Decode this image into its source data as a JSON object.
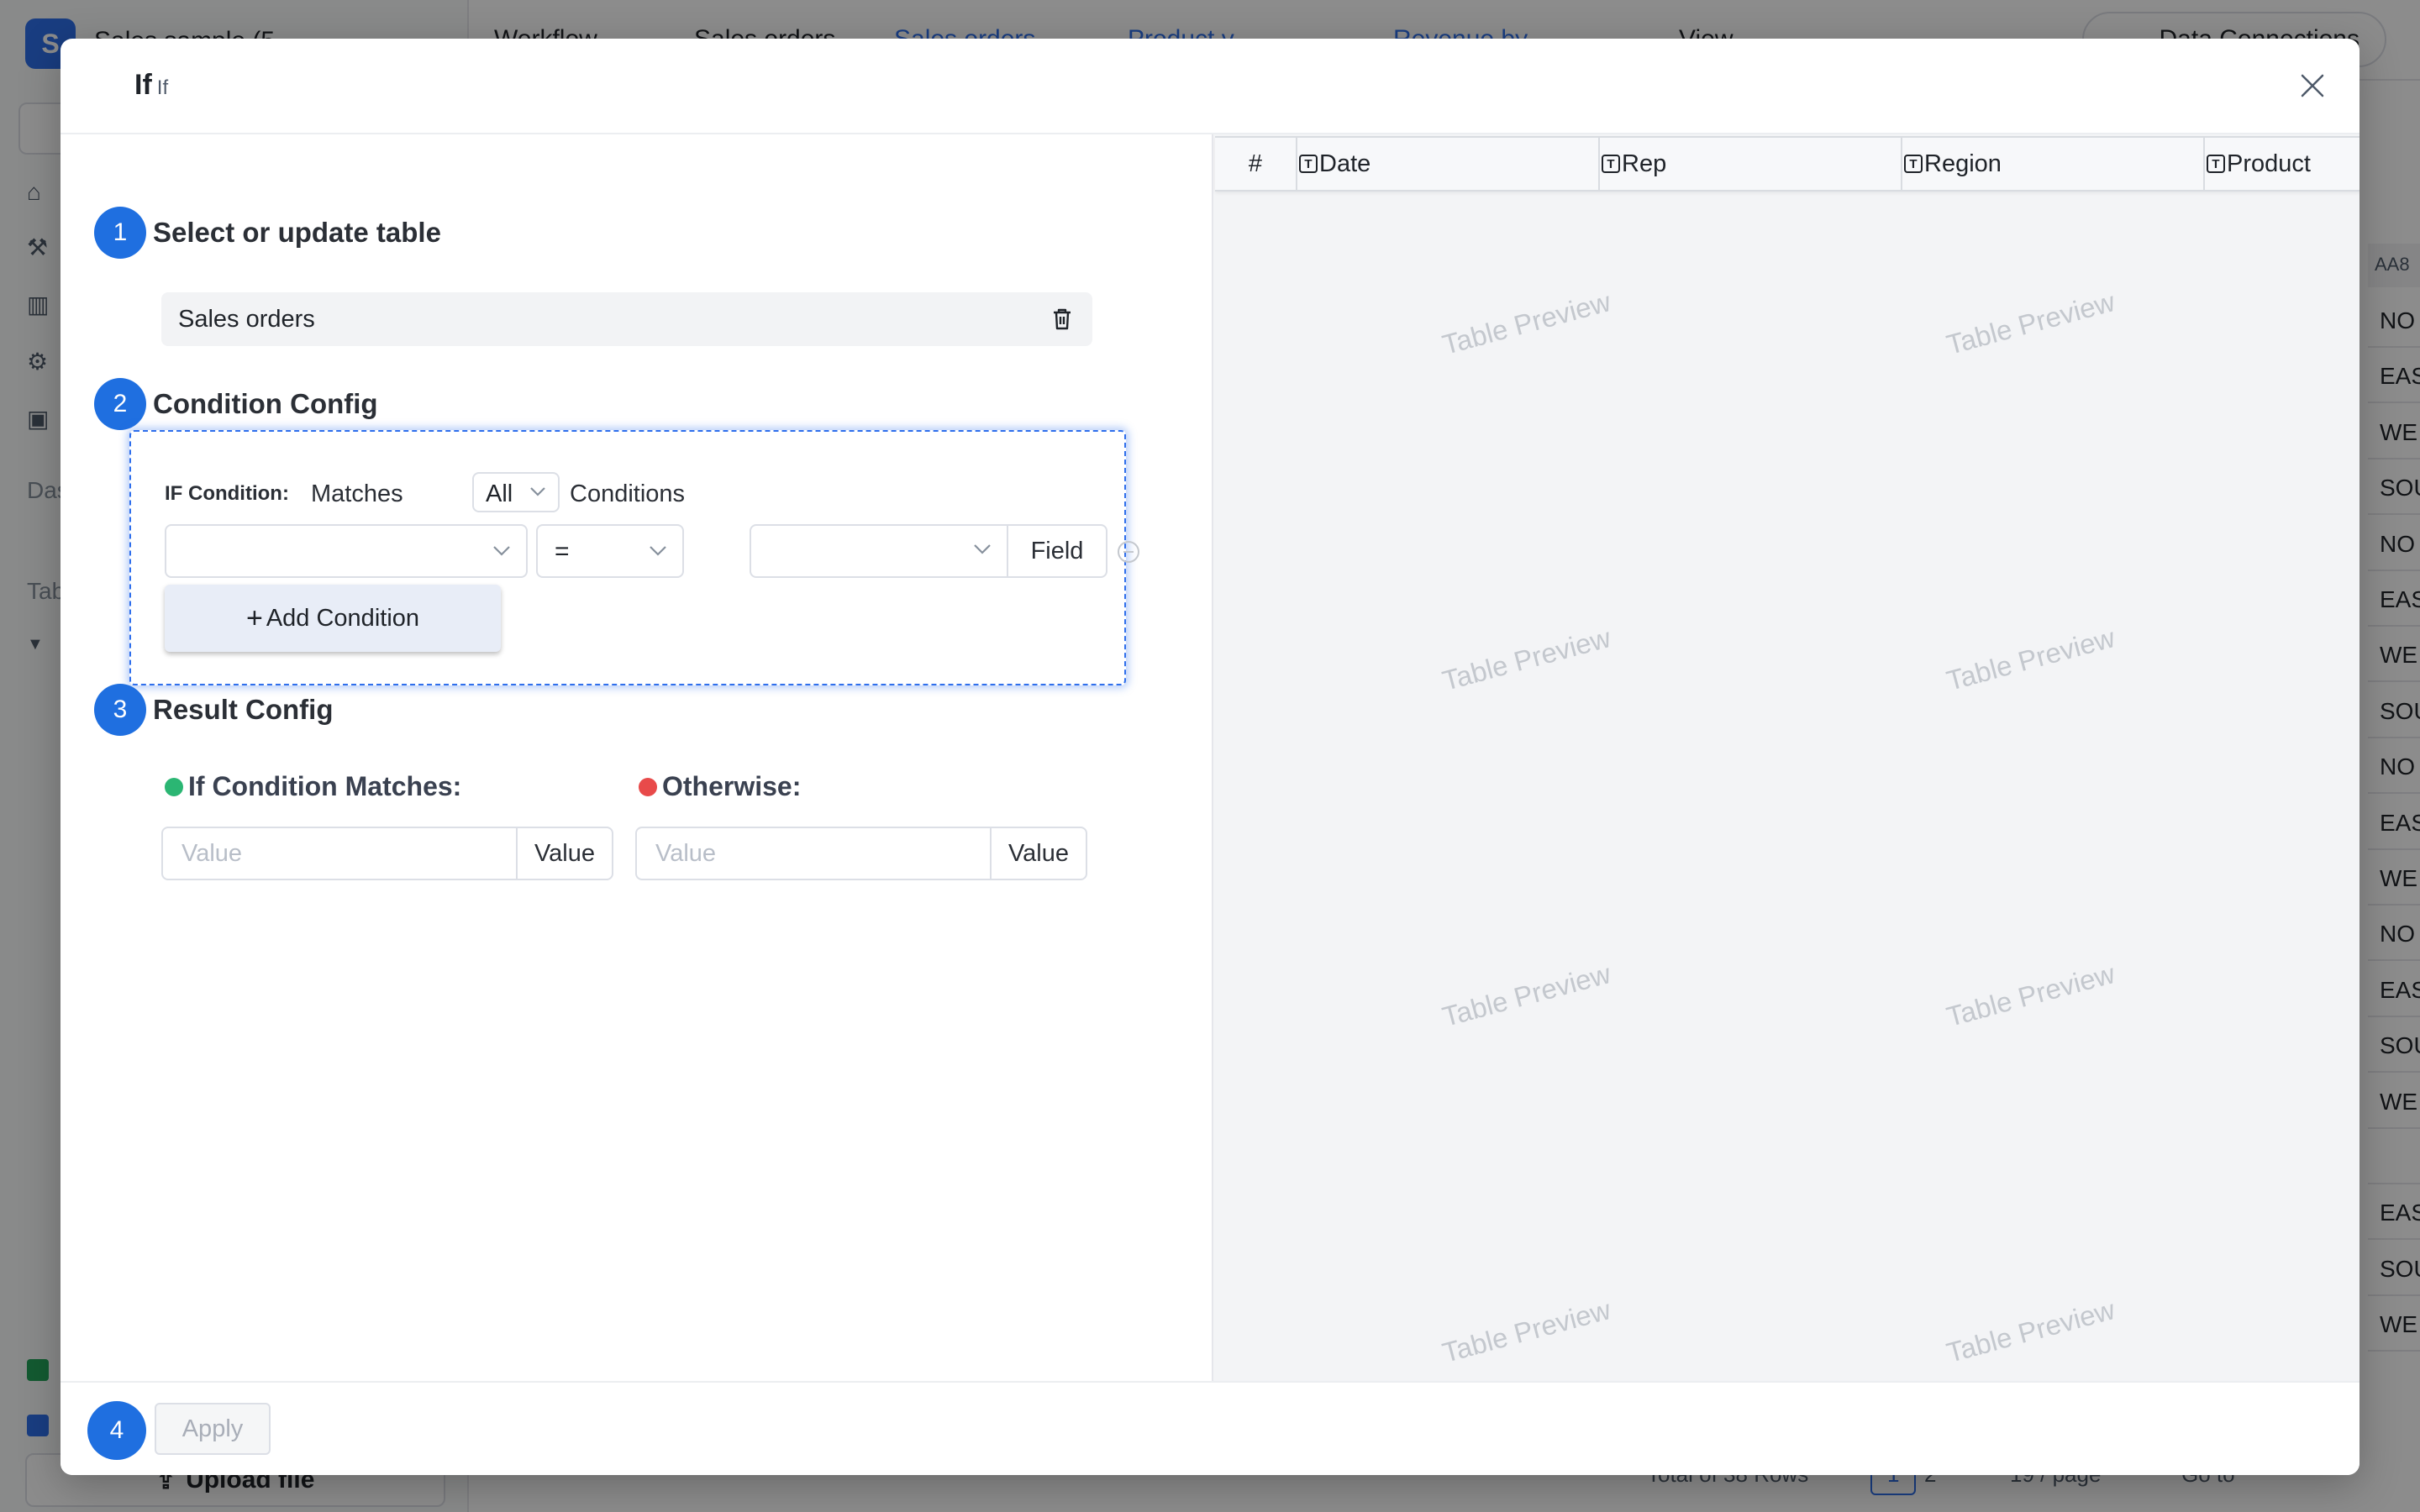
{
  "background": {
    "app_logo_letter": "S",
    "app_title": "Sales sample (5",
    "tabs": [
      {
        "label": "Workflow"
      },
      {
        "label": "Sales orders"
      },
      {
        "label": "Sales orders"
      },
      {
        "label": "Product v..."
      },
      {
        "label": "Revenue by..."
      },
      {
        "label": "View"
      }
    ],
    "data_connections": "Data Connections",
    "sidebar_das": "Das",
    "sidebar_tab": "Tab",
    "upload_label": "Upload file",
    "column_header": "AA8",
    "cells": [
      "NO",
      "EAS",
      "WE",
      "SOU",
      "NO",
      "EAS",
      "WE",
      "SOU",
      "NO",
      "EAS",
      "WE",
      "NO",
      "EAS",
      "SOU",
      "WE",
      "",
      "EAS",
      "SOU",
      "WE"
    ],
    "footer_total": "Total of 38 Rows",
    "footer_page_current": "1",
    "footer_page_next": "2",
    "footer_page_size": "19 / page",
    "footer_goto": "Go to"
  },
  "modal": {
    "title": "If",
    "subtitle": "If",
    "steps": {
      "step1": {
        "number": "1",
        "title": "Select or update table",
        "selected_table": "Sales orders"
      },
      "step2": {
        "number": "2",
        "title": "Condition Config",
        "if_condition_label": "IF Condition:",
        "matches_label": "Matches",
        "match_mode": "All",
        "conditions_label": "Conditions",
        "operator": "=",
        "field_button": "Field",
        "add_condition": "Add Condition"
      },
      "step3": {
        "number": "3",
        "title": "Result Config",
        "if_matches_label": "If Condition Matches:",
        "otherwise_label": "Otherwise:",
        "value_placeholder": "Value",
        "value_suffix": "Value",
        "match_color": "#2bb673",
        "otherwise_color": "#e84a4a"
      },
      "step4": {
        "number": "4",
        "apply_label": "Apply"
      }
    },
    "preview": {
      "columns": [
        "#",
        "Date",
        "Rep",
        "Region",
        "Product"
      ],
      "watermark": "Table Preview"
    }
  },
  "colors": {
    "accent": "#1f6fe0",
    "link": "#2f6fec"
  }
}
